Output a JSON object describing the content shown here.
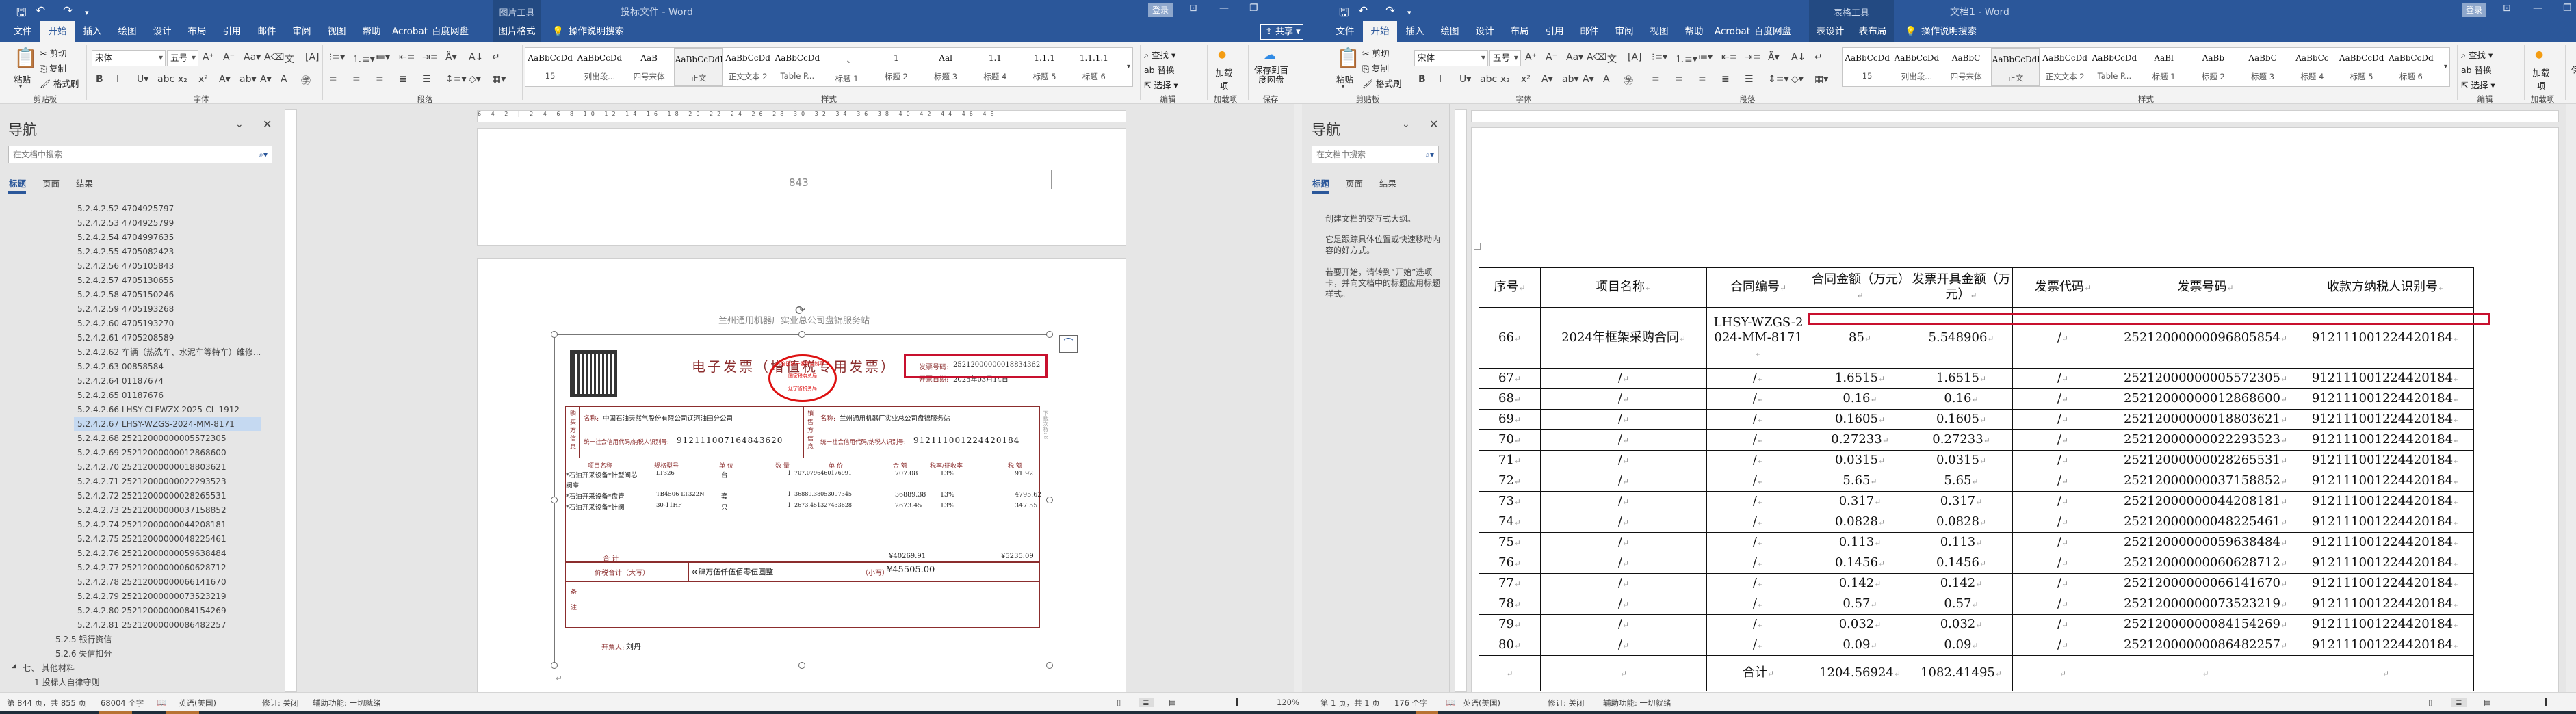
{
  "colors": {
    "brand": "#2b579a",
    "context": "#234a82",
    "highlight_box": "#c8102e",
    "invoice_ink": "#8b2d2d",
    "nav_selected": "#c5d9f1"
  },
  "ribbon_common": {
    "clipboard": {
      "paste": "粘贴",
      "cut": "剪切",
      "copy": "复制",
      "format_painter": "格式刷",
      "group": "剪贴板"
    },
    "font": {
      "name": "宋体",
      "size": "五号",
      "group": "字体"
    },
    "paragraph": {
      "group": "段落"
    },
    "styles": {
      "group": "样式"
    },
    "editing": {
      "find": "查找",
      "replace": "替换",
      "select": "选择",
      "group": "编辑"
    },
    "addins": {
      "button": "加载项",
      "group": "加载项"
    },
    "save": {
      "button": "保存到百度网盘",
      "group": "保存"
    },
    "tell_me": "操作说明搜索",
    "login": "登录",
    "share": "共享",
    "base_tabs": [
      "文件",
      "开始",
      "插入",
      "绘图",
      "设计",
      "布局",
      "引用",
      "邮件",
      "审阅",
      "视图",
      "帮助",
      "Acrobat",
      "百度网盘"
    ],
    "active_tab": "开始"
  },
  "left_window": {
    "title": "投标文件  -  Word",
    "context_tool": "图片工具",
    "context_tabs": [
      "图片格式"
    ],
    "styles": [
      {
        "preview": "AaBbCcDd",
        "name": "15"
      },
      {
        "preview": "AaBbCcDd",
        "name": "列出段..."
      },
      {
        "preview": "AaB",
        "name": "四号宋体"
      },
      {
        "preview": "AaBbCcDdI",
        "name": "正文",
        "selected": true
      },
      {
        "preview": "AaBbCcDd",
        "name": "正文文本 2"
      },
      {
        "preview": "AaBbCcDd",
        "name": "Table P..."
      },
      {
        "preview": "一、",
        "name": "标题 1"
      },
      {
        "preview": "1",
        "name": "标题 2"
      },
      {
        "preview": "Aal",
        "name": "标题 3"
      },
      {
        "preview": "1.1",
        "name": "标题 4"
      },
      {
        "preview": "1.1.1",
        "name": "标题 5"
      },
      {
        "preview": "1.1.1.1",
        "name": "标题 6"
      }
    ],
    "nav": {
      "title": "导航",
      "search_placeholder": "在文档中搜索",
      "tabs": [
        "标题",
        "页面",
        "结果"
      ],
      "items": [
        {
          "text": "5.2.4.2.52 4704925797",
          "level": 4
        },
        {
          "text": "5.2.4.2.53 4704925799",
          "level": 4
        },
        {
          "text": "5.2.4.2.54 4704997635",
          "level": 4
        },
        {
          "text": "5.2.4.2.55 4705082423",
          "level": 4
        },
        {
          "text": "5.2.4.2.56 4705105843",
          "level": 4
        },
        {
          "text": "5.2.4.2.57 4705130655",
          "level": 4
        },
        {
          "text": "5.2.4.2.58 4705150246",
          "level": 4
        },
        {
          "text": "5.2.4.2.59 4705193268",
          "level": 4
        },
        {
          "text": "5.2.4.2.60 4705193270",
          "level": 4
        },
        {
          "text": "5.2.4.2.61 4705208589",
          "level": 4
        },
        {
          "text": "5.2.4.2.62 车辆（热洗车、水泥车等特车）维修...",
          "level": 4
        },
        {
          "text": "5.2.4.2.63 00858584",
          "level": 4
        },
        {
          "text": "5.2.4.2.64 01187674",
          "level": 4
        },
        {
          "text": "5.2.4.2.65 01187676",
          "level": 4
        },
        {
          "text": "5.2.4.2.66 LHSY-CLFWZX-2025-CL-1912",
          "level": 4
        },
        {
          "text": "5.2.4.2.67 LHSY-WZGS-2024-MM-8171",
          "level": 4,
          "selected": true
        },
        {
          "text": "5.2.4.2.68 25212000000005572305",
          "level": 4
        },
        {
          "text": "5.2.4.2.69 25212000000012868600",
          "level": 4
        },
        {
          "text": "5.2.4.2.70 25212000000018803621",
          "level": 4
        },
        {
          "text": "5.2.4.2.71 25212000000022293523",
          "level": 4
        },
        {
          "text": "5.2.4.2.72 25212000000028265531",
          "level": 4
        },
        {
          "text": "5.2.4.2.73 25212000000037158852",
          "level": 4
        },
        {
          "text": "5.2.4.2.74 25212000000044208181",
          "level": 4
        },
        {
          "text": "5.2.4.2.75 25212000000048225461",
          "level": 4
        },
        {
          "text": "5.2.4.2.76 25212000000059638484",
          "level": 4
        },
        {
          "text": "5.2.4.2.77 25212000000060628712",
          "level": 4
        },
        {
          "text": "5.2.4.2.78 25212000000066141670",
          "level": 4
        },
        {
          "text": "5.2.4.2.79 25212000000073523219",
          "level": 4
        },
        {
          "text": "5.2.4.2.80 25212000000084154269",
          "level": 4
        },
        {
          "text": "5.2.4.2.81 25212000000086482257",
          "level": 4
        },
        {
          "text": "5.2.5 银行资信",
          "level": 3
        },
        {
          "text": "5.2.6 失信扣分",
          "level": 3
        },
        {
          "text": "七、 其他材料",
          "level": 0,
          "expanded": true
        },
        {
          "text": "1 投标人自律守则",
          "level": 1
        }
      ]
    },
    "document": {
      "page_number": "843",
      "invoice": {
        "header_text": "兰州通用机器厂实业总公司盘锦服务站",
        "title": "电子发票（增值税专用发票）",
        "invoice_no_label": "发票号码:",
        "invoice_no": "25212000000018834362",
        "date_label": "开票日期:",
        "date": "2025年03月14日",
        "seal_lines": [
          "全国统一发票监制章",
          "国家税务总局",
          "辽宁省税务局"
        ],
        "buyer_label": "购买方信息",
        "seller_label": "销售方信息",
        "name_label": "名称:",
        "taxid_label": "统一社会信用代码/纳税人识别号:",
        "buyer_name": "中国石油天然气股份有限公司辽河油田分公司",
        "buyer_taxid": "912111007164843620",
        "seller_name": "兰州通用机器厂实业总公司盘锦服务站",
        "seller_taxid": "912111001224420184",
        "download_count": "下载次数: 8",
        "columns": [
          "项目名称",
          "规格型号",
          "单 位",
          "数 量",
          "单 价",
          "金 额",
          "税率/征收率",
          "税 额"
        ],
        "items": [
          {
            "name": "*石油开采设备*针型阀芯",
            "name2": "阀座",
            "model": "LT326",
            "unit": "台",
            "qty": "1",
            "price": "707.0796460176991",
            "amount": "707.08",
            "rate": "13%",
            "tax": "91.92"
          },
          {
            "name": "*石油开采设备*盘管",
            "model": "TB4506 LT322N",
            "unit": "套",
            "qty": "1",
            "price": "36889.38053097345",
            "amount": "36889.38",
            "rate": "13%",
            "tax": "4795.62"
          },
          {
            "name": "*石油开采设备*针阀",
            "model": "30-11HF",
            "unit": "只",
            "qty": "1",
            "price": "2673.451327433628",
            "amount": "2673.45",
            "rate": "13%",
            "tax": "347.55"
          }
        ],
        "total_label": "合          计",
        "total_amount": "¥40269.91",
        "total_tax": "¥5235.09",
        "grand_label": "价税合计（大写）",
        "grand_upper": "⊗肆万伍仟伍佰零伍圆整",
        "grand_lower_label": "（小写）",
        "grand_lower": "¥45505.00",
        "remark_label": "备注",
        "issuer_label": "开票人:",
        "issuer": "刘丹"
      }
    },
    "status": {
      "page": "第 844 页，共 855 页",
      "words": "68004 个字",
      "language": "英语(美国)",
      "track": "修订: 关闭",
      "accessibility": "辅助功能: 一切就绪",
      "zoom": "120%"
    }
  },
  "right_window": {
    "title": "文档1  -  Word",
    "context_tool": "表格工具",
    "context_tabs": [
      "表设计",
      "表布局"
    ],
    "styles": [
      {
        "preview": "AaBbCcDd",
        "name": "15"
      },
      {
        "preview": "AaBbCcDd",
        "name": "列出段..."
      },
      {
        "preview": "AaBbC",
        "name": "四号宋体"
      },
      {
        "preview": "AaBbCcDdI",
        "name": "正文",
        "selected": true
      },
      {
        "preview": "AaBbCcDd",
        "name": "正文文本 2"
      },
      {
        "preview": "AaBbCcDd",
        "name": "Table P..."
      },
      {
        "preview": "AaBl",
        "name": "标题 1"
      },
      {
        "preview": "AaBb",
        "name": "标题 2"
      },
      {
        "preview": "AaBbC",
        "name": "标题 3"
      },
      {
        "preview": "AaBbCc",
        "name": "标题 4"
      },
      {
        "preview": "AaBbCcDd",
        "name": "标题 5"
      },
      {
        "preview": "AaBbCcDd",
        "name": "标题 6"
      }
    ],
    "nav": {
      "title": "导航",
      "search_placeholder": "在文档中搜索",
      "tabs": [
        "标题",
        "页面",
        "结果"
      ],
      "hints": [
        "创建文档的交互式大纲。",
        "它是跟踪具体位置或快速移动内容的好方式。",
        "若要开始，请转到“开始”选项卡，并向文档中的标题应用标题样式。"
      ]
    },
    "table": {
      "headers": [
        "序号",
        "项目名称",
        "合同编号",
        "合同金额（万元）",
        "发票开具金额（万元）",
        "发票代码",
        "发票号码",
        "收款方纳税人识别号"
      ],
      "rows": [
        [
          "66",
          "2024年框架采购合同",
          "LHSY-WZGS-2024-MM-8171",
          "85",
          "5.548906",
          "/",
          "25212000000096805854",
          "912111001224420184"
        ],
        [
          "67",
          "/",
          "/",
          "1.6515",
          "1.6515",
          "/",
          "25212000000005572305",
          "912111001224420184"
        ],
        [
          "68",
          "/",
          "/",
          "0.16",
          "0.16",
          "/",
          "25212000000012868600",
          "912111001224420184"
        ],
        [
          "69",
          "/",
          "/",
          "0.1605",
          "0.1605",
          "/",
          "25212000000018803621",
          "912111001224420184"
        ],
        [
          "70",
          "/",
          "/",
          "0.27233",
          "0.27233",
          "/",
          "25212000000022293523",
          "912111001224420184"
        ],
        [
          "71",
          "/",
          "/",
          "0.0315",
          "0.0315",
          "/",
          "25212000000028265531",
          "912111001224420184"
        ],
        [
          "72",
          "/",
          "/",
          "5.65",
          "5.65",
          "/",
          "25212000000037158852",
          "912111001224420184"
        ],
        [
          "73",
          "/",
          "/",
          "0.317",
          "0.317",
          "/",
          "25212000000044208181",
          "912111001224420184"
        ],
        [
          "74",
          "/",
          "/",
          "0.0828",
          "0.0828",
          "/",
          "25212000000048225461",
          "912111001224420184"
        ],
        [
          "75",
          "/",
          "/",
          "0.113",
          "0.113",
          "/",
          "25212000000059638484",
          "912111001224420184"
        ],
        [
          "76",
          "/",
          "/",
          "0.1456",
          "0.1456",
          "/",
          "25212000000060628712",
          "912111001224420184"
        ],
        [
          "77",
          "/",
          "/",
          "0.142",
          "0.142",
          "/",
          "25212000000066141670",
          "912111001224420184"
        ],
        [
          "78",
          "/",
          "/",
          "0.57",
          "0.57",
          "/",
          "25212000000073523219",
          "912111001224420184"
        ],
        [
          "79",
          "/",
          "/",
          "0.032",
          "0.032",
          "/",
          "25212000000084154269",
          "912111001224420184"
        ],
        [
          "80",
          "/",
          "/",
          "0.09",
          "0.09",
          "/",
          "25212000000086482257",
          "912111001224420184"
        ],
        [
          "",
          "",
          "合计",
          "1204.56924",
          "1082.41495",
          "",
          "",
          ""
        ]
      ]
    },
    "status": {
      "page": "第 1 页，共 1 页",
      "words": "176 个字",
      "language": "英语(美国)",
      "track": "修订: 关闭",
      "accessibility": "辅助功能: 一切就绪"
    }
  }
}
